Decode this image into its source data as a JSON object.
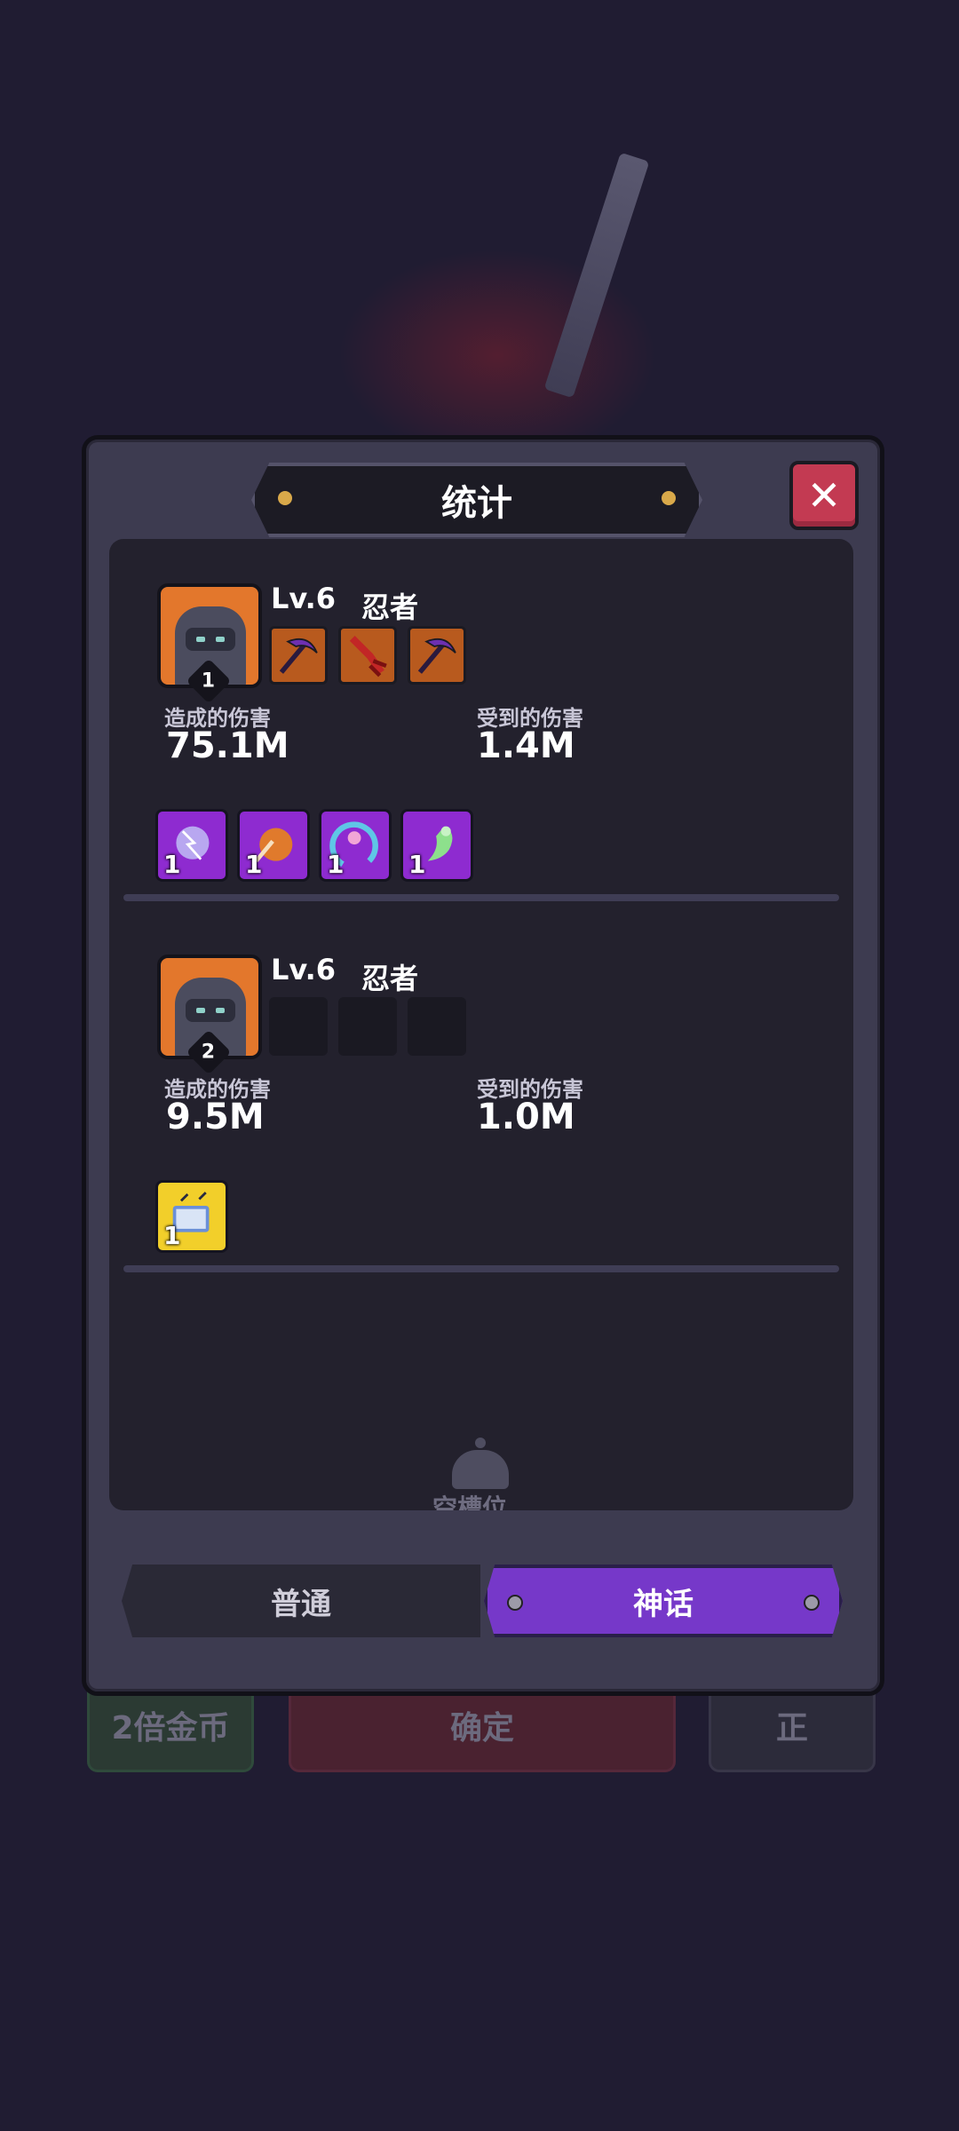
{
  "background": {
    "buttons": [
      {
        "label": "2倍金币"
      },
      {
        "label": "确定"
      },
      {
        "label": "正"
      }
    ]
  },
  "dialog": {
    "title": "统计",
    "close_label": "✕"
  },
  "heroes": [
    {
      "rank": "1",
      "level": "Lv.6",
      "class": "忍者",
      "damage_dealt_label": "造成的伤害",
      "damage_dealt": "75.1M",
      "damage_taken_label": "受到的伤害",
      "damage_taken": "1.4M",
      "equipment": [
        "scythe-icon",
        "red-claw-icon",
        "scythe-icon"
      ],
      "skills": [
        {
          "icon": "lightning-orb-icon",
          "count": "1",
          "color": "#8e2bd0"
        },
        {
          "icon": "fireball-icon",
          "count": "1",
          "color": "#8e2bd0"
        },
        {
          "icon": "vortex-icon",
          "count": "1",
          "color": "#8e2bd0"
        },
        {
          "icon": "ghost-icon",
          "count": "1",
          "color": "#8e2bd0"
        }
      ]
    },
    {
      "rank": "2",
      "level": "Lv.6",
      "class": "忍者",
      "damage_dealt_label": "造成的伤害",
      "damage_dealt": "9.5M",
      "damage_taken_label": "受到的伤害",
      "damage_taken": "1.0M",
      "equipment": [],
      "skills": [
        {
          "icon": "spellbook-icon",
          "count": "1",
          "color": "#f2cf2a"
        }
      ]
    }
  ],
  "empty_slot_label": "空槽位",
  "tabs": {
    "normal": "普通",
    "myth": "神话",
    "selected": "myth"
  },
  "colors": {
    "accent_purple": "#7638c9",
    "close_red": "#c33a52",
    "portrait_orange": "#e3772c"
  }
}
